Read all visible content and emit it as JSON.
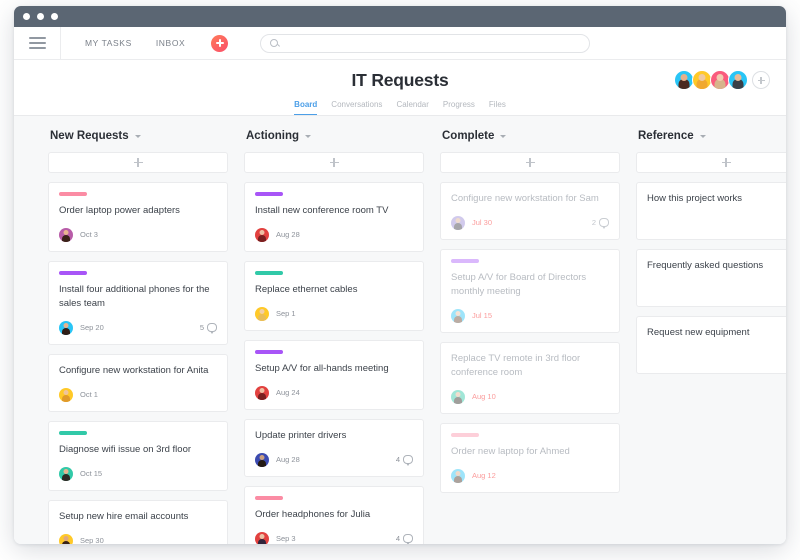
{
  "window": {
    "titlebar_dots": [
      "dot",
      "dot",
      "dot"
    ]
  },
  "topnav": {
    "menu_icon": "hamburger-icon",
    "links": [
      {
        "label": "MY TASKS"
      },
      {
        "label": "INBOX"
      }
    ],
    "add_button_label": "+",
    "search": {
      "value": "",
      "placeholder": "",
      "icon": "search-icon"
    }
  },
  "header": {
    "title": "IT Requests",
    "tabs": [
      {
        "label": "Board",
        "active": true
      },
      {
        "label": "Conversations",
        "active": false
      },
      {
        "label": "Calendar",
        "active": false
      },
      {
        "label": "Progress",
        "active": false
      },
      {
        "label": "Files",
        "active": false
      }
    ],
    "members": [
      {
        "ring": "#29c5f6",
        "hair": "#4a2a21",
        "skin": "#e6b08c"
      },
      {
        "ring": "#ffc928",
        "hair": "#f0a830",
        "skin": "#f0c9a0"
      },
      {
        "ring": "#fa5b7d",
        "hair": "#d7b48b",
        "skin": "#f2cbb0"
      },
      {
        "ring": "#29c5f6",
        "hair": "#3a3f48",
        "skin": "#e8bb98"
      }
    ],
    "add_member_label": "+"
  },
  "board": {
    "columns": [
      {
        "title": "New Requests",
        "add_label": "+",
        "cards": [
          {
            "tag": "#fb8ca4",
            "title": "Order laptop power adapters",
            "date": "Oct 3",
            "comments": null,
            "done": false,
            "avatar": {
              "ring": "#b85ca8",
              "hair": "#3a2218",
              "skin": "#e8b48f"
            }
          },
          {
            "tag": "#a855f7",
            "title": "Install four additional phones for the sales team",
            "date": "Sep 20",
            "comments": "5",
            "done": false,
            "avatar": {
              "ring": "#29c5f6",
              "hair": "#2f1d16",
              "skin": "#e8b48f"
            }
          },
          {
            "tag": null,
            "title": "Configure new workstation for Anita",
            "date": "Oct 1",
            "comments": null,
            "done": false,
            "avatar": {
              "ring": "#ffc928",
              "hair": "#e09a2a",
              "skin": "#f0c49c"
            }
          },
          {
            "tag": "#31c9a8",
            "title": "Diagnose wifi issue on 3rd floor",
            "date": "Oct 15",
            "comments": null,
            "done": false,
            "avatar": {
              "ring": "#31c9a8",
              "hair": "#2f2a24",
              "skin": "#e8b48f"
            }
          },
          {
            "tag": null,
            "title": "Setup new hire email accounts",
            "date": "Sep 30",
            "comments": null,
            "done": false,
            "avatar": {
              "ring": "#ffc928",
              "hair": "#3a2218",
              "skin": "#e0a87f"
            }
          }
        ]
      },
      {
        "title": "Actioning",
        "add_label": "+",
        "cards": [
          {
            "tag": "#a855f7",
            "title": "Install new conference room TV",
            "date": "Aug 28",
            "comments": null,
            "done": false,
            "avatar": {
              "ring": "#e2413f",
              "hair": "#7a2020",
              "skin": "#eec0a4"
            }
          },
          {
            "tag": "#31c9a8",
            "title": "Replace ethernet cables",
            "date": "Sep 1",
            "comments": null,
            "done": false,
            "avatar": {
              "ring": "#ffc928",
              "hair": "#e8bd5a",
              "skin": "#f2cfa8"
            }
          },
          {
            "tag": "#a855f7",
            "title": "Setup A/V for all-hands meeting",
            "date": "Aug 24",
            "comments": null,
            "done": false,
            "avatar": {
              "ring": "#e2413f",
              "hair": "#7a2020",
              "skin": "#eec0a4"
            }
          },
          {
            "tag": null,
            "title": "Update printer drivers",
            "date": "Aug 28",
            "comments": "4",
            "done": false,
            "avatar": {
              "ring": "#3c4bb0",
              "hair": "#241a14",
              "skin": "#caa080"
            }
          },
          {
            "tag": "#fb8ca4",
            "title": "Order headphones for Julia",
            "date": "Sep 3",
            "comments": "4",
            "done": false,
            "avatar": {
              "ring": "#e2413f",
              "hair": "#31243a",
              "skin": "#ecc2a6"
            }
          }
        ]
      },
      {
        "title": "Complete",
        "add_label": "+",
        "cards": [
          {
            "tag": null,
            "title": "Configure new workstation for Sam",
            "date": "Jul 30",
            "comments": "2",
            "done": true,
            "avatar": {
              "ring": "#9b8cd6",
              "hair": "#3b3a44",
              "skin": "#dcb195"
            }
          },
          {
            "tag": "#a855f7",
            "title": "Setup A/V for Board of Directors monthly meeting",
            "date": "Jul 15",
            "comments": null,
            "done": true,
            "avatar": {
              "ring": "#29c5f6",
              "hair": "#6b4a34",
              "skin": "#e8c1a4"
            }
          },
          {
            "tag": null,
            "title": "Replace TV remote in 3rd floor conference room",
            "date": "Aug 10",
            "comments": null,
            "done": true,
            "avatar": {
              "ring": "#31c9a8",
              "hair": "#2f2a24",
              "skin": "#e2b694"
            }
          },
          {
            "tag": "#fb8ca4",
            "title": "Order new laptop for Ahmed",
            "date": "Aug 12",
            "comments": null,
            "done": true,
            "avatar": {
              "ring": "#29c5f6",
              "hair": "#4a3226",
              "skin": "#dbac8c"
            }
          }
        ]
      },
      {
        "title": "Reference",
        "add_label": "+",
        "cards": [
          {
            "tag": null,
            "title": "How this project works",
            "date": null,
            "comments": null,
            "done": false,
            "avatar": null
          },
          {
            "tag": null,
            "title": "Frequently asked questions",
            "date": null,
            "comments": null,
            "done": false,
            "avatar": null
          },
          {
            "tag": null,
            "title": "Request new equipment",
            "date": null,
            "comments": null,
            "done": false,
            "avatar": null
          }
        ]
      }
    ]
  }
}
